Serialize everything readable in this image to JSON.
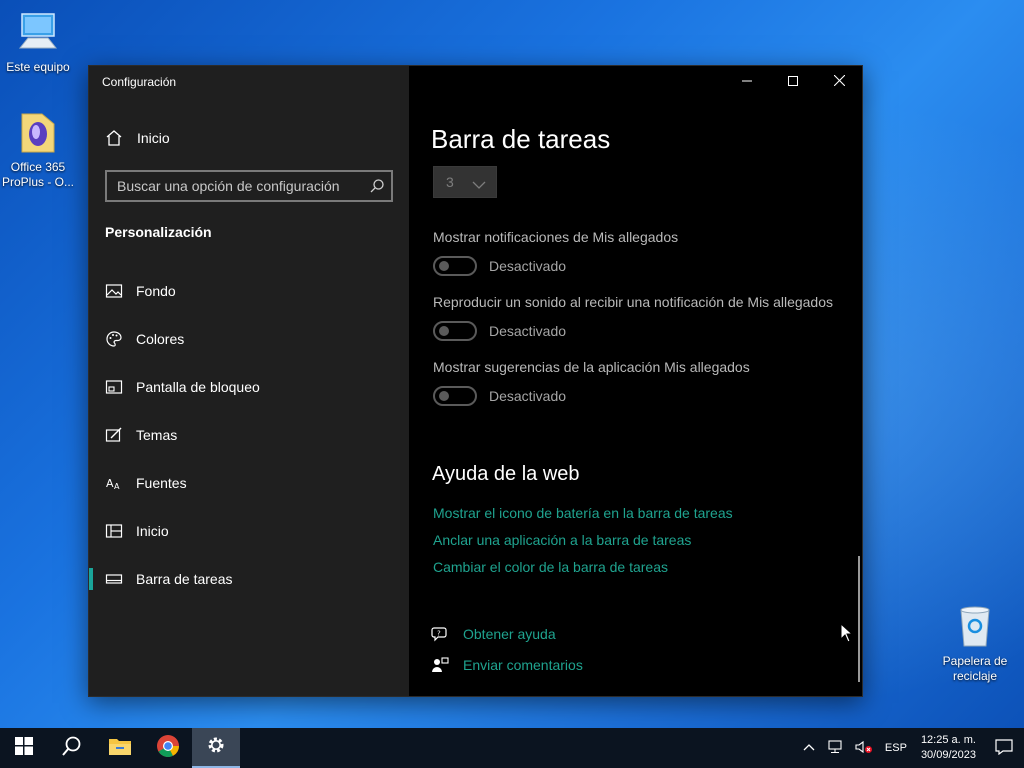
{
  "desktop": {
    "icons": [
      {
        "label": "Este equipo"
      },
      {
        "label": "Office 365 ProPlus - O..."
      },
      {
        "label": "Papelera de reciclaje"
      }
    ]
  },
  "window": {
    "title": "Configuración",
    "controls": {
      "minimize": "minimize-icon",
      "maximize": "maximize-icon",
      "close": "close-icon"
    }
  },
  "sidebar": {
    "home_label": "Inicio",
    "search_placeholder": "Buscar una opción de configuración",
    "section_title": "Personalización",
    "items": [
      {
        "label": "Fondo",
        "icon": "picture-icon"
      },
      {
        "label": "Colores",
        "icon": "palette-icon"
      },
      {
        "label": "Pantalla de bloqueo",
        "icon": "lock-screen-icon"
      },
      {
        "label": "Temas",
        "icon": "themes-icon"
      },
      {
        "label": "Fuentes",
        "icon": "fonts-icon"
      },
      {
        "label": "Inicio",
        "icon": "start-icon"
      },
      {
        "label": "Barra de tareas",
        "icon": "taskbar-icon",
        "active": true
      }
    ]
  },
  "content": {
    "title": "Barra de tareas",
    "dropdown_value": "3",
    "settings": [
      {
        "label": "Mostrar notificaciones de Mis allegados",
        "state": "Desactivado",
        "on": false
      },
      {
        "label": "Reproducir un sonido al recibir una notificación de Mis allegados",
        "state": "Desactivado",
        "on": false
      },
      {
        "label": "Mostrar sugerencias de la aplicación Mis allegados",
        "state": "Desactivado",
        "on": false
      }
    ],
    "web_help_title": "Ayuda de la web",
    "links": [
      "Mostrar el icono de batería en la barra de tareas",
      "Anclar una aplicación a la barra de tareas",
      "Cambiar el color de la barra de tareas"
    ],
    "help": {
      "get_help": "Obtener ayuda",
      "feedback": "Enviar comentarios"
    }
  },
  "taskbar": {
    "language": "ESP",
    "time": "12:25 a. m.",
    "date": "30/09/2023"
  },
  "colors": {
    "accent": "#1aa59a",
    "link": "#1fa38f",
    "sidebar_bg": "#1f1f1f",
    "content_bg": "#000000"
  }
}
